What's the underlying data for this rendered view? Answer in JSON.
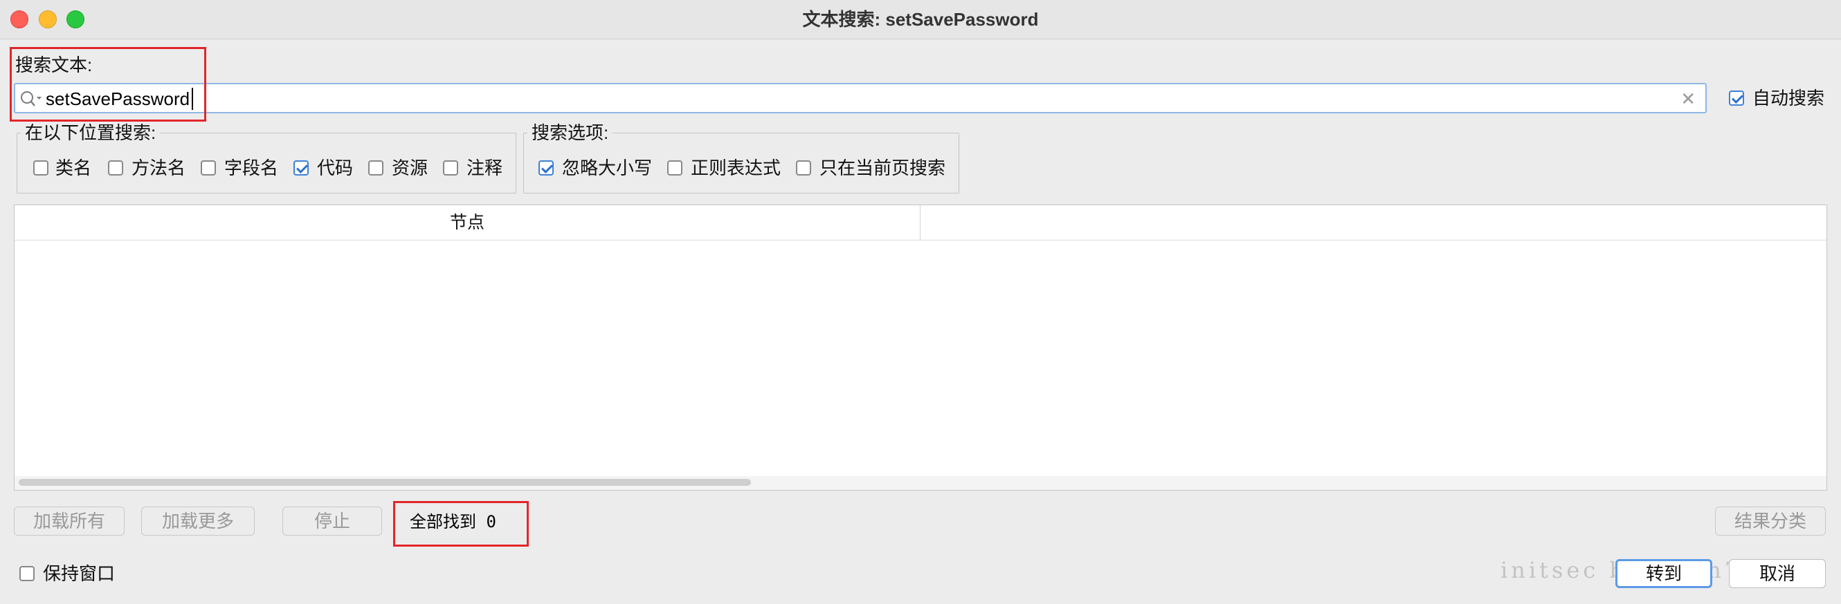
{
  "window": {
    "title": "文本搜索: setSavePassword"
  },
  "search": {
    "label": "搜索文本:",
    "value": "setSavePassword",
    "auto_search": {
      "label": "自动搜索",
      "checked": true
    }
  },
  "search_in": {
    "legend": "在以下位置搜索:",
    "options": [
      {
        "label": "类名",
        "checked": false
      },
      {
        "label": "方法名",
        "checked": false
      },
      {
        "label": "字段名",
        "checked": false
      },
      {
        "label": "代码",
        "checked": true
      },
      {
        "label": "资源",
        "checked": false
      },
      {
        "label": "注释",
        "checked": false
      }
    ]
  },
  "search_options": {
    "legend": "搜索选项:",
    "options": [
      {
        "label": "忽略大小写",
        "checked": true
      },
      {
        "label": "正则表达式",
        "checked": false
      },
      {
        "label": "只在当前页搜索",
        "checked": false
      }
    ]
  },
  "results": {
    "columns": [
      "节点",
      ""
    ]
  },
  "bottom": {
    "load_all": "加载所有",
    "load_more": "加载更多",
    "stop": "停止",
    "status": "全部找到 0",
    "group_results": "结果分类",
    "keep_window": {
      "label": "保持窗口",
      "checked": false
    },
    "goto": "转到",
    "cancel": "取消"
  },
  "watermark": "initsec blog.gm7.org",
  "colors": {
    "highlight_box": "#e1262b",
    "focus_border": "#5b9ae6",
    "checkbox_accent": "#2f6fd0"
  }
}
